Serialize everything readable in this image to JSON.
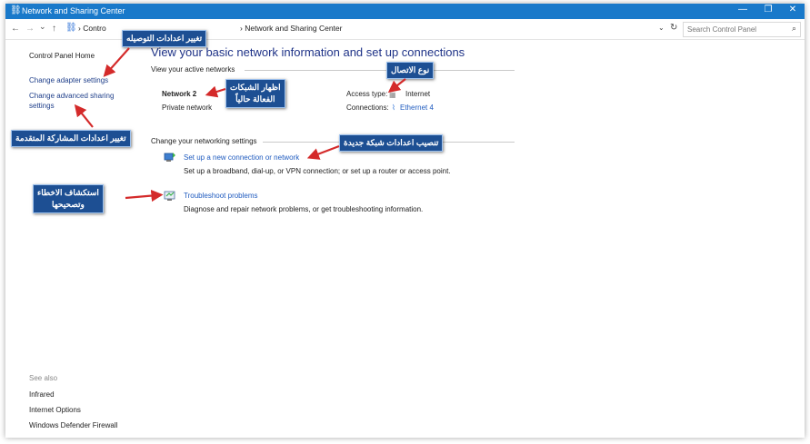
{
  "window": {
    "title": "Network and Sharing Center",
    "minimize_label": "—",
    "maximize_label": "❐",
    "close_label": "✕"
  },
  "address_bar": {
    "back_label": "←",
    "forward_label": "→",
    "recent_label": "⌄",
    "up_label": "↑",
    "crumb_1": "Contro",
    "crumb_sep": "›",
    "crumb_2": "Network and Sharing Center",
    "dropdown_label": "⌄",
    "refresh_label": "↻",
    "search_placeholder": "Search Control Panel"
  },
  "sidebar": {
    "home": "Control Panel Home",
    "adapter": "Change adapter settings",
    "advanced_line1": "Change advanced sharing",
    "advanced_line2": "settings",
    "see_also_title": "See also",
    "see_also_items": [
      "Infrared",
      "Internet Options",
      "Windows Defender Firewall"
    ]
  },
  "main": {
    "title": "View your basic network information and set up connections",
    "active_header": "View your active networks",
    "network_name": "Network  2",
    "network_type": "Private network",
    "access_type_label": "Access type:",
    "access_type_value": "Internet",
    "connections_label": "Connections:",
    "connections_value": "Ethernet 4",
    "change_header": "Change your networking settings",
    "setup_link": "Set up a new connection or network",
    "setup_desc": "Set up a broadband, dial-up, or VPN connection; or set up a router or access point.",
    "troubleshoot_link": "Troubleshoot problems",
    "troubleshoot_desc": "Diagnose and repair network problems, or get troubleshooting information."
  },
  "callouts": {
    "adapter_settings": "تغيير اعدادات التوصيله",
    "active_networks_1": "اظهار الشبكات",
    "active_networks_2": "الفعالة حالياً",
    "connection_type": "نوع الاتصال",
    "advanced_sharing": "تغيير اعدادات المشاركة المتقدمة",
    "new_network": "تنصيب اعدادات شبكة جديدة",
    "troubleshoot_1": "استكشاف الاخطاء",
    "troubleshoot_2": "وتصحيحها"
  },
  "colors": {
    "titlebar": "#1979ca",
    "link": "#1f5bbf",
    "title_text": "#1e3287",
    "callout_bg": "#1d4f93",
    "arrow": "#d42a2a"
  },
  "icons": {
    "window": "network-icon",
    "search": "search-icon",
    "setup": "new-connection-icon",
    "troubleshoot": "troubleshoot-icon",
    "ethernet": "ethernet-icon"
  }
}
